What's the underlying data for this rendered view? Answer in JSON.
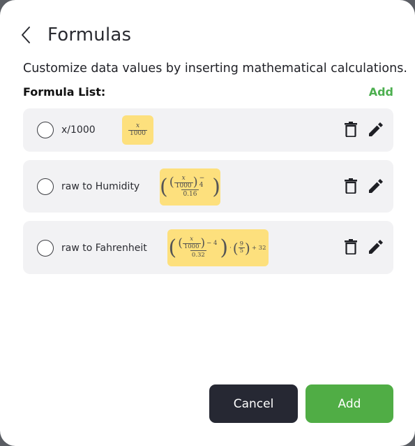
{
  "header": {
    "title": "Formulas",
    "back_icon": "chevron-left-icon"
  },
  "description": "Customize data values by inserting mathematical calculations.",
  "formula_list": {
    "label": "Formula List:",
    "add_label": "Add",
    "items": [
      {
        "name": "x/1000",
        "preview": {
          "num": "x",
          "den": "1000"
        }
      },
      {
        "name": "raw to Humidity",
        "preview": {
          "x": "x",
          "div": "1000",
          "minus": "− 4",
          "den": "0.16"
        }
      },
      {
        "name": "raw to Fahrenheit",
        "preview": {
          "x": "x",
          "div": "1000",
          "minus": "− 4",
          "den": "0.32",
          "dot": "·",
          "n9": "9",
          "n5": "5",
          "plus": "+ 32"
        }
      }
    ]
  },
  "actions": {
    "cancel_label": "Cancel",
    "add_label": "Add"
  },
  "colors": {
    "accent_green": "#50ad45",
    "dark_button": "#262833",
    "formula_highlight": "#fde07d",
    "row_bg": "#f2f2f4"
  }
}
